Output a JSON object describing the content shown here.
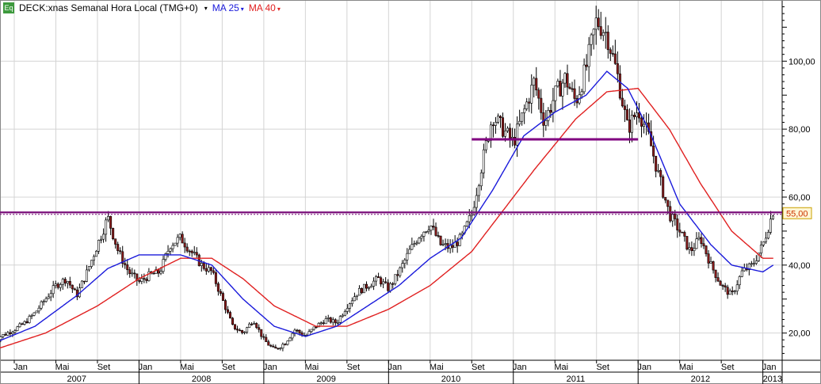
{
  "header": {
    "badge": "Eq",
    "title": "DECK:xnas Semanal Hora Local (TMG+0)",
    "ma_short_label": "MA 25",
    "ma_long_label": "MA 40",
    "caret": "▾"
  },
  "colors": {
    "price": "#000000",
    "ma_short": "#1a1adb",
    "ma_long": "#e02020",
    "line_55": "#7a0f7a",
    "line_77": "#800080",
    "price_tag_bg": "#fff7d6",
    "price_tag_text": "#cc3300",
    "grid": "#d4d4d4"
  },
  "chart_data": {
    "type": "candlestick",
    "title": "DECK:xnas Semanal Hora Local (TMG+0)",
    "ylim": [
      12,
      118
    ],
    "y_ticks": [
      {
        "value": 20,
        "label": "20,00"
      },
      {
        "value": 40,
        "label": "40,00"
      },
      {
        "value": 60,
        "label": "60,00"
      },
      {
        "value": 80,
        "label": "80,00"
      },
      {
        "value": 100,
        "label": "100,00"
      }
    ],
    "current_price_label": "55,00",
    "months": [
      {
        "label": "Jan",
        "date": "2007-01"
      },
      {
        "label": "Mai",
        "date": "2007-05"
      },
      {
        "label": "Set",
        "date": "2007-09"
      },
      {
        "label": "Jan",
        "date": "2008-01"
      },
      {
        "label": "Mai",
        "date": "2008-05"
      },
      {
        "label": "Set",
        "date": "2008-09"
      },
      {
        "label": "Jan",
        "date": "2009-01"
      },
      {
        "label": "Mai",
        "date": "2009-05"
      },
      {
        "label": "Set",
        "date": "2009-09"
      },
      {
        "label": "Jan",
        "date": "2010-01"
      },
      {
        "label": "Mai",
        "date": "2010-05"
      },
      {
        "label": "Set",
        "date": "2010-09"
      },
      {
        "label": "Jan",
        "date": "2011-01"
      },
      {
        "label": "Mai",
        "date": "2011-05"
      },
      {
        "label": "Set",
        "date": "2011-09"
      },
      {
        "label": "Jan",
        "date": "2012-01"
      },
      {
        "label": "Mai",
        "date": "2012-05"
      },
      {
        "label": "Set",
        "date": "2012-09"
      },
      {
        "label": "Jan",
        "date": "2013-01"
      }
    ],
    "years": [
      {
        "label": "2007",
        "start": "2007-01"
      },
      {
        "label": "2008",
        "start": "2008-01"
      },
      {
        "label": "2009",
        "start": "2009-01"
      },
      {
        "label": "2010",
        "start": "2010-01"
      },
      {
        "label": "2011",
        "start": "2011-01"
      },
      {
        "label": "2012",
        "start": "2012-01"
      },
      {
        "label": "2013",
        "start": "2013-01"
      }
    ],
    "horizontal_lines": [
      {
        "value": 55.5,
        "from": "2006-11",
        "to": "2013-03",
        "style": "dotted"
      },
      {
        "value": 77,
        "from": "2010-09",
        "to": "2012-01",
        "style": "solid"
      }
    ],
    "price_anchors": [
      [
        "2006-11",
        18
      ],
      [
        "2007-01",
        21
      ],
      [
        "2007-02",
        23
      ],
      [
        "2007-03",
        26
      ],
      [
        "2007-04",
        30
      ],
      [
        "2007-05",
        34
      ],
      [
        "2007-06",
        36
      ],
      [
        "2007-07",
        31
      ],
      [
        "2007-08",
        38
      ],
      [
        "2007-09",
        46
      ],
      [
        "2007-10",
        54
      ],
      [
        "2007-11",
        44
      ],
      [
        "2007-12",
        38
      ],
      [
        "2008-01",
        35
      ],
      [
        "2008-02",
        37
      ],
      [
        "2008-03",
        38
      ],
      [
        "2008-04",
        46
      ],
      [
        "2008-05",
        48
      ],
      [
        "2008-06",
        44
      ],
      [
        "2008-07",
        40
      ],
      [
        "2008-08",
        38
      ],
      [
        "2008-09",
        30
      ],
      [
        "2008-10",
        22
      ],
      [
        "2008-11",
        20
      ],
      [
        "2008-12",
        24
      ],
      [
        "2009-01",
        18
      ],
      [
        "2009-02",
        15
      ],
      [
        "2009-03",
        17
      ],
      [
        "2009-04",
        21
      ],
      [
        "2009-05",
        19
      ],
      [
        "2009-06",
        22
      ],
      [
        "2009-07",
        24
      ],
      [
        "2009-08",
        23
      ],
      [
        "2009-09",
        28
      ],
      [
        "2009-10",
        32
      ],
      [
        "2009-11",
        34
      ],
      [
        "2009-12",
        36
      ],
      [
        "2010-01",
        33
      ],
      [
        "2010-02",
        38
      ],
      [
        "2010-03",
        44
      ],
      [
        "2010-04",
        49
      ],
      [
        "2010-05",
        52
      ],
      [
        "2010-06",
        46
      ],
      [
        "2010-07",
        45
      ],
      [
        "2010-08",
        48
      ],
      [
        "2010-09",
        55
      ],
      [
        "2010-10",
        70
      ],
      [
        "2010-11",
        84
      ],
      [
        "2010-12",
        80
      ],
      [
        "2011-01",
        76
      ],
      [
        "2011-02",
        85
      ],
      [
        "2011-03",
        94
      ],
      [
        "2011-04",
        82
      ],
      [
        "2011-05",
        90
      ],
      [
        "2011-06",
        95
      ],
      [
        "2011-07",
        88
      ],
      [
        "2011-08",
        98
      ],
      [
        "2011-09",
        112
      ],
      [
        "2011-10",
        108
      ],
      [
        "2011-11",
        96
      ],
      [
        "2011-12",
        80
      ],
      [
        "2012-01",
        86
      ],
      [
        "2012-02",
        78
      ],
      [
        "2012-03",
        66
      ],
      [
        "2012-04",
        55
      ],
      [
        "2012-05",
        50
      ],
      [
        "2012-06",
        44
      ],
      [
        "2012-07",
        48
      ],
      [
        "2012-08",
        40
      ],
      [
        "2012-09",
        34
      ],
      [
        "2012-10",
        31
      ],
      [
        "2012-11",
        38
      ],
      [
        "2012-12",
        40
      ],
      [
        "2013-01",
        46
      ],
      [
        "2013-02",
        56
      ]
    ],
    "ma_short_anchors": [
      [
        "2006-11",
        17
      ],
      [
        "2007-03",
        22
      ],
      [
        "2007-07",
        31
      ],
      [
        "2007-10",
        39
      ],
      [
        "2008-01",
        43
      ],
      [
        "2008-05",
        43
      ],
      [
        "2008-08",
        40
      ],
      [
        "2008-11",
        30
      ],
      [
        "2009-02",
        22
      ],
      [
        "2009-05",
        19
      ],
      [
        "2009-08",
        22
      ],
      [
        "2009-11",
        28
      ],
      [
        "2010-02",
        34
      ],
      [
        "2010-05",
        42
      ],
      [
        "2010-08",
        48
      ],
      [
        "2010-11",
        62
      ],
      [
        "2011-02",
        78
      ],
      [
        "2011-05",
        85
      ],
      [
        "2011-08",
        90
      ],
      [
        "2011-10",
        97
      ],
      [
        "2011-12",
        92
      ],
      [
        "2012-02",
        80
      ],
      [
        "2012-05",
        58
      ],
      [
        "2012-08",
        46
      ],
      [
        "2012-10",
        40
      ],
      [
        "2013-01",
        38
      ],
      [
        "2013-02",
        40
      ]
    ],
    "ma_long_anchors": [
      [
        "2006-11",
        15
      ],
      [
        "2007-04",
        20
      ],
      [
        "2007-09",
        28
      ],
      [
        "2008-01",
        36
      ],
      [
        "2008-05",
        42
      ],
      [
        "2008-08",
        42
      ],
      [
        "2008-11",
        36
      ],
      [
        "2009-02",
        28
      ],
      [
        "2009-06",
        22
      ],
      [
        "2009-09",
        22
      ],
      [
        "2010-01",
        27
      ],
      [
        "2010-05",
        34
      ],
      [
        "2010-09",
        44
      ],
      [
        "2010-12",
        56
      ],
      [
        "2011-03",
        68
      ],
      [
        "2011-07",
        83
      ],
      [
        "2011-10",
        91
      ],
      [
        "2012-01",
        92
      ],
      [
        "2012-04",
        80
      ],
      [
        "2012-07",
        64
      ],
      [
        "2012-10",
        50
      ],
      [
        "2013-01",
        42
      ],
      [
        "2013-02",
        42
      ]
    ]
  }
}
